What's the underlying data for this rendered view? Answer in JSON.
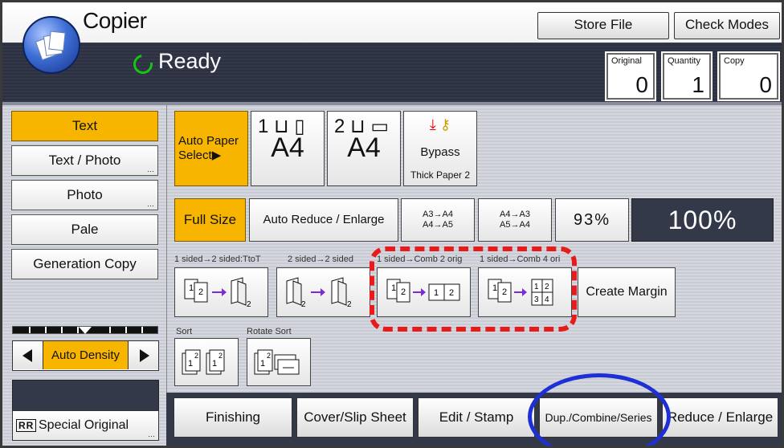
{
  "header": {
    "app_title": "Copier",
    "store_file_label": "Store File",
    "check_modes_label": "Check Modes",
    "status_text": "Ready",
    "counters": {
      "original_label": "Original",
      "original_value": "0",
      "quantity_label": "Quantity",
      "quantity_value": "1",
      "copy_label": "Copy",
      "copy_value": "0"
    }
  },
  "original_type": {
    "items": [
      "Text",
      "Text / Photo",
      "Photo",
      "Pale",
      "Generation Copy"
    ],
    "selected": "Text"
  },
  "density": {
    "label": "Auto Density"
  },
  "special_original": {
    "icon_text": "R",
    "label": "Special Original"
  },
  "paper": {
    "auto_paper_label": "Auto Paper Select▶",
    "tray1_number": "1",
    "tray1_size": "A4",
    "tray2_number": "2",
    "tray2_size": "A4",
    "bypass_label": "Bypass",
    "bypass_sub": "Thick Paper 2"
  },
  "reduce_enlarge": {
    "full_size_label": "Full Size",
    "auto_reduce_label": "Auto Reduce / Enlarge",
    "ratio1_line1": "A3→A4",
    "ratio1_line2": "A4→A5",
    "ratio2_line1": "A4→A3",
    "ratio2_line2": "A5→A4",
    "ratio3_label": "93%",
    "zoom_display": "100%"
  },
  "duplex": {
    "labels": [
      "1 sided→2 sided:TtoT",
      "2 sided→2 sided",
      "1 sided→Comb 2 orig",
      "1 sided→Comb 4 ori"
    ],
    "create_margin_label": "Create Margin"
  },
  "sort": {
    "sort_label": "Sort",
    "rotate_sort_label": "Rotate Sort"
  },
  "bottom_tabs": [
    "Finishing",
    "Cover/Slip Sheet",
    "Edit / Stamp",
    "Dup./Combine/Series",
    "Reduce / Enlarge"
  ],
  "colors": {
    "selected": "#f7b500",
    "status_bar": "#34394a",
    "highlight_dashed": "#e81b1b",
    "highlight_oval": "#1f2fd6"
  }
}
